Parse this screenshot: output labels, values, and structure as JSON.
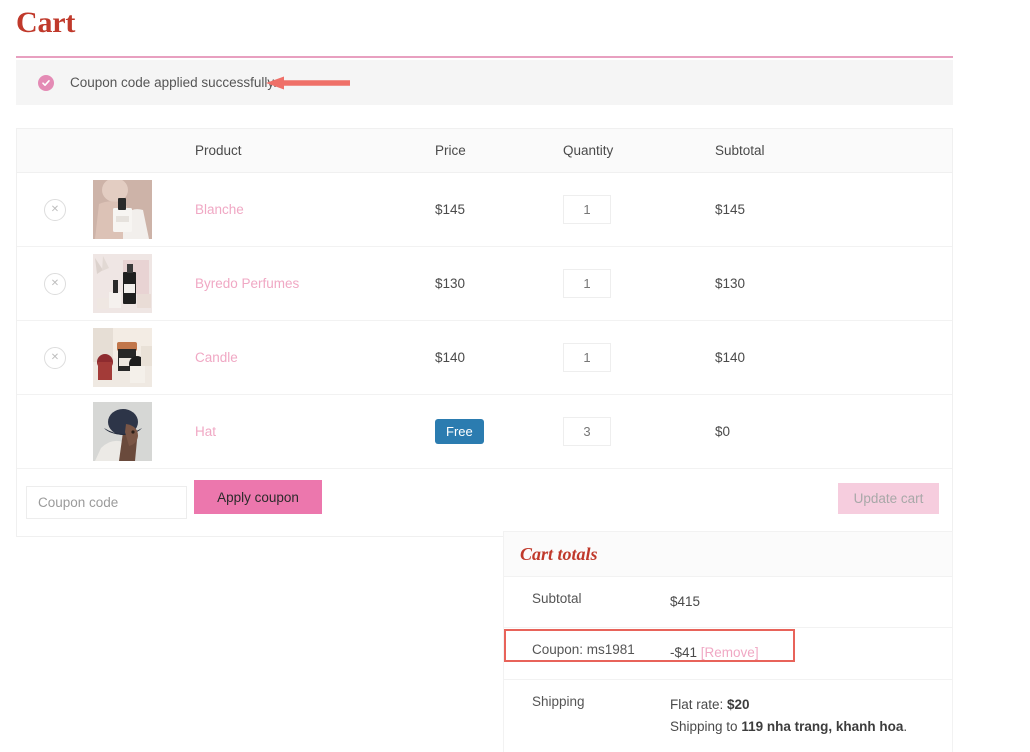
{
  "page": {
    "title": "Cart"
  },
  "notice": {
    "icon": "check-circle-icon",
    "message": "Coupon code applied successfully."
  },
  "annotations": {
    "arrow": "left-arrow-annotation",
    "arrow_color": "#ef7068",
    "box_color": "#e8635a"
  },
  "cart_table": {
    "columns": {
      "remove": "",
      "thumbnail": "",
      "product": "Product",
      "price": "Price",
      "quantity": "Quantity",
      "subtotal": "Subtotal"
    },
    "rows": [
      {
        "removable": true,
        "thumb": "perfume-bottle-thumbnail",
        "name": "Blanche",
        "price": "$145",
        "price_is_badge": false,
        "quantity": "1",
        "subtotal": "$145"
      },
      {
        "removable": true,
        "thumb": "perfume-set-thumbnail",
        "name": "Byredo Perfumes",
        "price": "$130",
        "price_is_badge": false,
        "quantity": "1",
        "subtotal": "$130"
      },
      {
        "removable": true,
        "thumb": "candles-thumbnail",
        "name": "Candle",
        "price": "$140",
        "price_is_badge": false,
        "quantity": "1",
        "subtotal": "$140"
      },
      {
        "removable": false,
        "thumb": "bucket-hat-thumbnail",
        "name": "Hat",
        "price": "Free",
        "price_is_badge": true,
        "quantity": "3",
        "subtotal": "$0"
      }
    ]
  },
  "actions": {
    "coupon_placeholder": "Coupon code",
    "coupon_value": "",
    "apply_label": "Apply coupon",
    "update_label": "Update cart"
  },
  "totals": {
    "title": "Cart totals",
    "subtotal_label": "Subtotal",
    "subtotal_value": "$415",
    "coupon_label": "Coupon: ms1981",
    "coupon_value": "-$41",
    "coupon_remove": "[Remove]",
    "shipping_label": "Shipping",
    "shipping_rate_prefix": "Flat rate: ",
    "shipping_rate_value": "$20",
    "shipping_to_prefix": "Shipping to ",
    "shipping_to_address": "119 nha trang, khanh hoa",
    "shipping_to_suffix": "."
  },
  "colors": {
    "brand_red": "#c0392b",
    "pink": "#ec77ad",
    "link_pink": "#f0a8c4",
    "badge_blue": "#2b7cb0",
    "rule_pink": "#e8a0c0"
  }
}
